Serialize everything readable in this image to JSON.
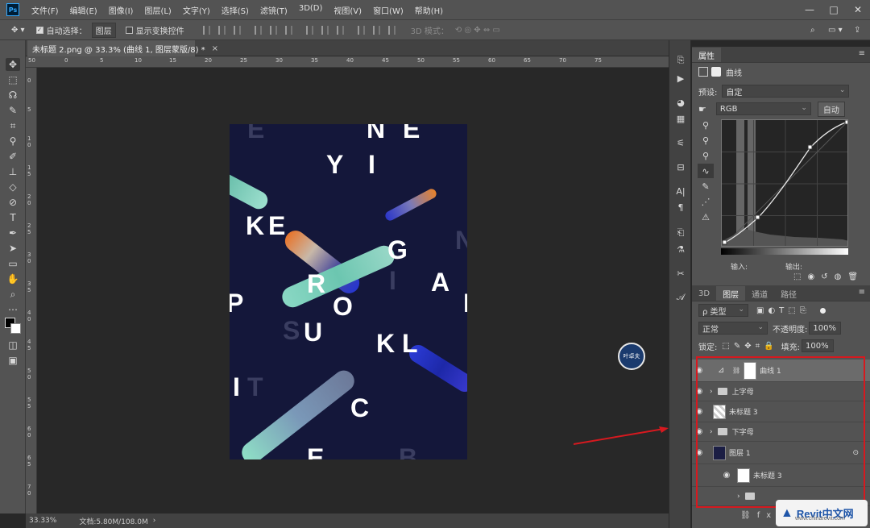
{
  "app": {
    "logo": "Ps",
    "menu": [
      "文件(F)",
      "编辑(E)",
      "图像(I)",
      "图层(L)",
      "文字(Y)",
      "选择(S)",
      "滤镜(T)",
      "3D(D)",
      "视图(V)",
      "窗口(W)",
      "帮助(H)"
    ],
    "window_controls": [
      "—",
      "□",
      "✕"
    ]
  },
  "options": {
    "auto_select_label": "自动选择：",
    "auto_select_value": "图层",
    "show_transform_label": "显示变换控件",
    "mode_3d_label": "3D 模式："
  },
  "document": {
    "tab_title": "未标题 2.png @ 33.3% (曲线 1, 图层蒙版/8) *",
    "close": "×",
    "zoom": "33.33%",
    "doc_info": "文档:5.80M/108.0M"
  },
  "rulers": {
    "top": [
      "50",
      "0",
      "5",
      "10",
      "15",
      "20",
      "25",
      "30",
      "35",
      "40",
      "45",
      "50",
      "55",
      "60",
      "65",
      "70",
      "75"
    ],
    "left": [
      "0",
      "5",
      "1 0",
      "1 5",
      "2 0",
      "2 5",
      "3 0",
      "3 5",
      "4 0",
      "4 5",
      "5 0",
      "5 5",
      "6 0",
      "6 5",
      "7 0"
    ]
  },
  "poster": {
    "letters": [
      {
        "t": "E",
        "ghost": true
      },
      {
        "t": "N",
        "ghost": false
      },
      {
        "t": "E",
        "ghost": false
      },
      {
        "t": "Y",
        "ghost": false
      },
      {
        "t": "I",
        "ghost": false
      },
      {
        "t": "K",
        "ghost": false
      },
      {
        "t": "E",
        "ghost": false
      },
      {
        "t": "N",
        "ghost": true
      },
      {
        "t": "G",
        "ghost": false
      },
      {
        "t": "I",
        "ghost": true
      },
      {
        "t": "A",
        "ghost": false
      },
      {
        "t": "P",
        "ghost": false
      },
      {
        "t": "R",
        "ghost": false
      },
      {
        "t": "P",
        "ghost": false
      },
      {
        "t": "O",
        "ghost": false
      },
      {
        "t": "S",
        "ghost": true
      },
      {
        "t": "U",
        "ghost": false
      },
      {
        "t": "K",
        "ghost": false
      },
      {
        "t": "L",
        "ghost": false
      },
      {
        "t": "I",
        "ghost": false
      },
      {
        "t": "T",
        "ghost": true
      },
      {
        "t": "C",
        "ghost": false
      },
      {
        "t": "E",
        "ghost": false
      },
      {
        "t": "B",
        "ghost": true
      }
    ]
  },
  "badge": "叶卓夫",
  "properties": {
    "tab": "属性",
    "title": "曲线",
    "preset_label": "预设:",
    "preset_value": "自定",
    "channel": "RGB",
    "auto": "自动",
    "input_label": "输入:",
    "output_label": "输出:"
  },
  "layers": {
    "tabs": [
      "3D",
      "图层",
      "通道",
      "路径"
    ],
    "kind_filter": "ρ 类型",
    "blend_mode": "正常",
    "opacity_label": "不透明度:",
    "opacity_value": "100%",
    "lock_label": "锁定:",
    "fill_label": "填充:",
    "fill_value": "100%",
    "rows": [
      {
        "name": "曲线 1",
        "type": "adjustment"
      },
      {
        "name": "上字母",
        "type": "group"
      },
      {
        "name": "未标题 3",
        "type": "smart"
      },
      {
        "name": "下字母",
        "type": "group"
      },
      {
        "name": "图层 1",
        "type": "smart"
      },
      {
        "name": "未标题 3",
        "type": "smart-child"
      },
      {
        "name": "",
        "type": "group-child"
      }
    ]
  },
  "watermark": {
    "brand": "Revit中文网",
    "url": "www.chinarevit.com"
  },
  "colors": {
    "highlight": "#d6191f",
    "accent": "#31a8ff"
  }
}
